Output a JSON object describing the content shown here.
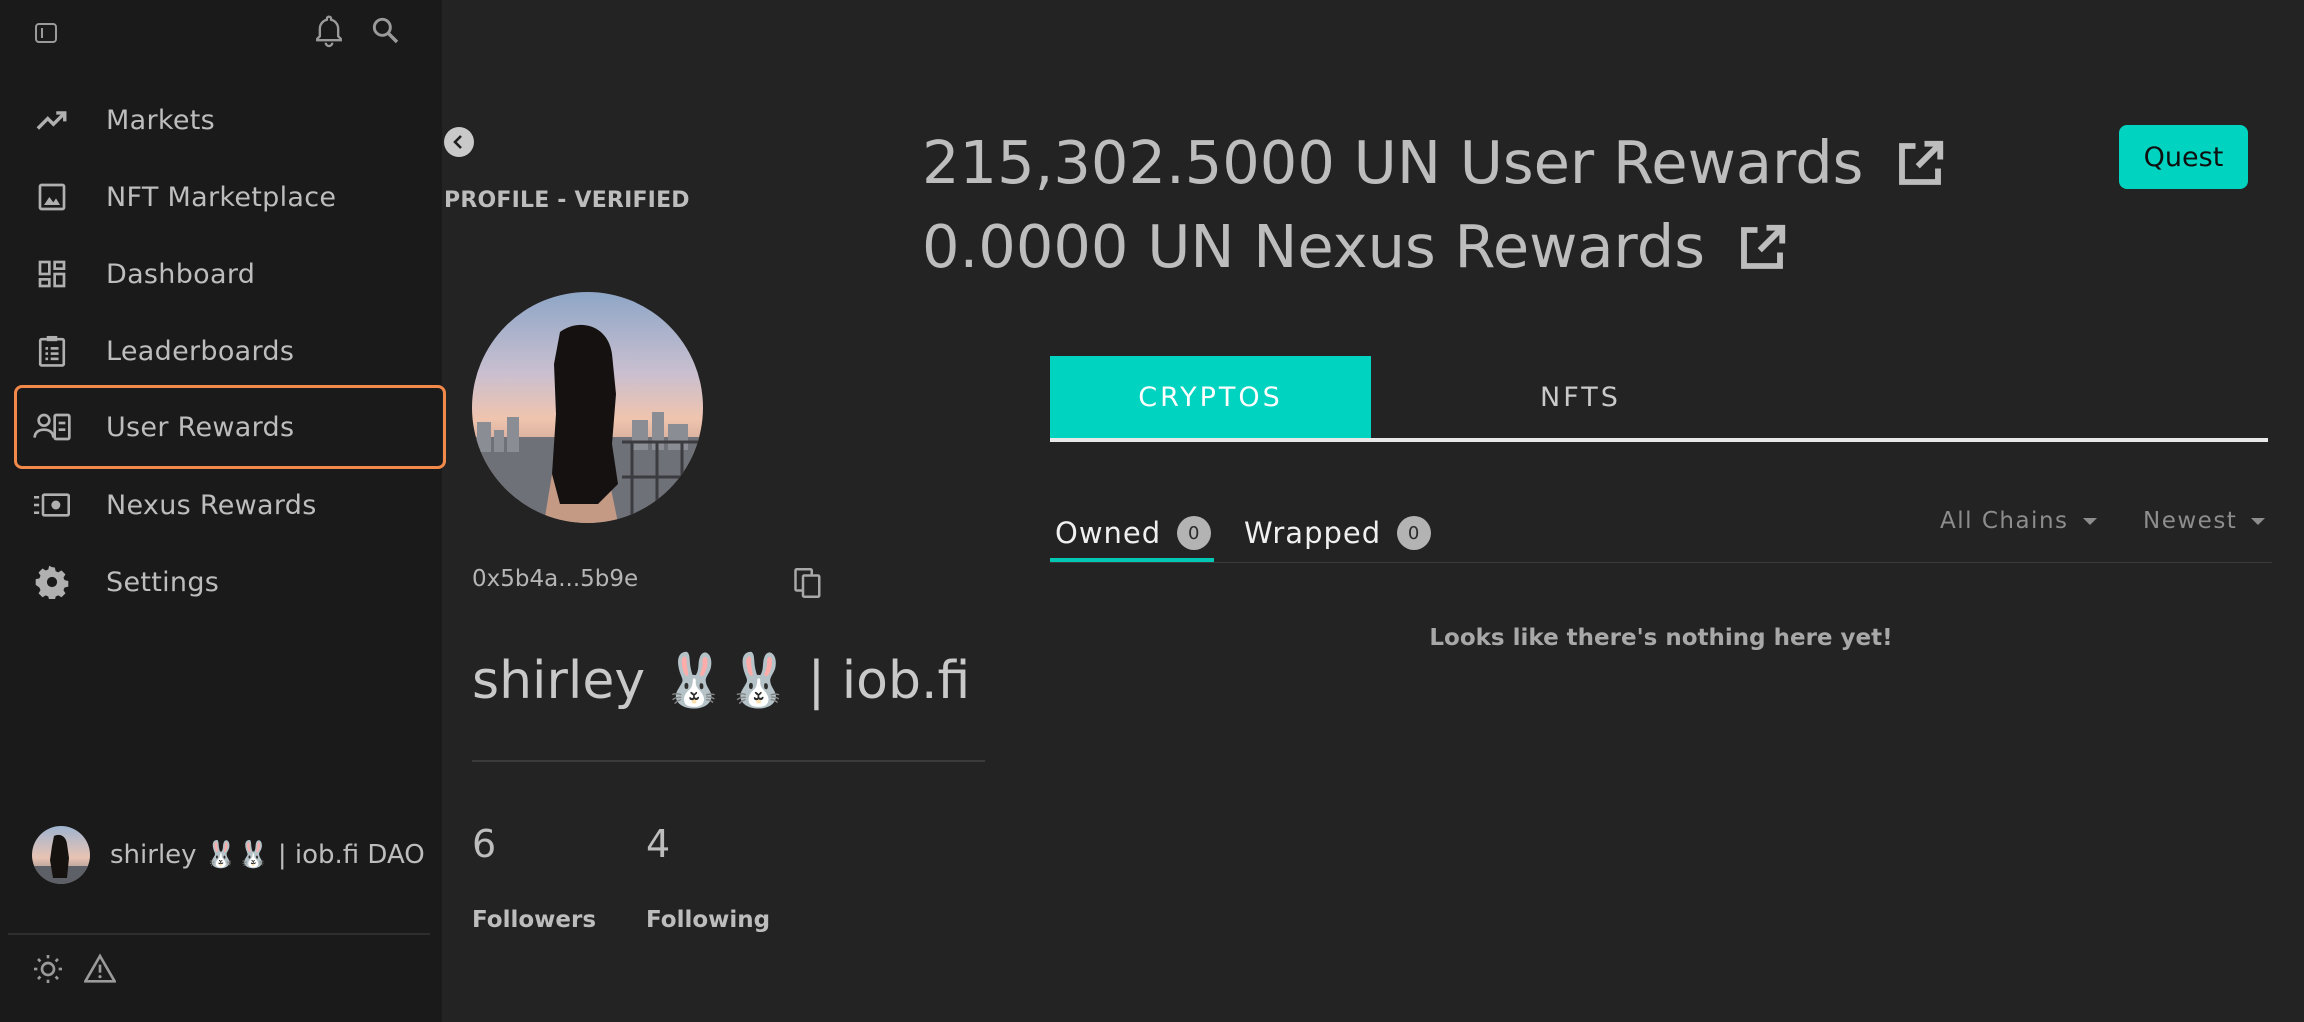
{
  "sidebar": {
    "items": [
      {
        "label": "Markets",
        "icon": "trending-up-icon"
      },
      {
        "label": "NFT Marketplace",
        "icon": "image-icon"
      },
      {
        "label": "Dashboard",
        "icon": "dashboard-icon"
      },
      {
        "label": "Leaderboards",
        "icon": "clipboard-list-icon"
      },
      {
        "label": "User Rewards",
        "icon": "user-card-icon",
        "active": true
      },
      {
        "label": "Nexus Rewards",
        "icon": "money-icon"
      },
      {
        "label": "Settings",
        "icon": "gear-icon"
      }
    ],
    "user_name": "shirley 🐰🐰 | iob.fi DAO"
  },
  "profile": {
    "status": "PROFILE - VERIFIED",
    "wallet": "0x5b4a...5b9e",
    "display_name": "shirley 🐰🐰 | iob.fi ...",
    "followers_count": "6",
    "followers_label": "Followers",
    "following_count": "4",
    "following_label": "Following"
  },
  "rewards": {
    "user_rewards": "215,302.5000 UN User Rewards",
    "nexus_rewards": "0.0000 UN Nexus Rewards"
  },
  "quest_label": "Quest",
  "tabs": {
    "cryptos": "CRYPTOS",
    "nfts": "NFTS"
  },
  "subtabs": {
    "owned": "Owned",
    "owned_count": "0",
    "wrapped": "Wrapped",
    "wrapped_count": "0"
  },
  "filters": {
    "chain": "All Chains",
    "sort": "Newest"
  },
  "empty_message": "Looks like there's nothing here yet!",
  "colors": {
    "accent": "#00d4c0",
    "active_border": "#f0894a",
    "sidebar_bg": "#1a1a1a",
    "page_bg": "#232323"
  }
}
